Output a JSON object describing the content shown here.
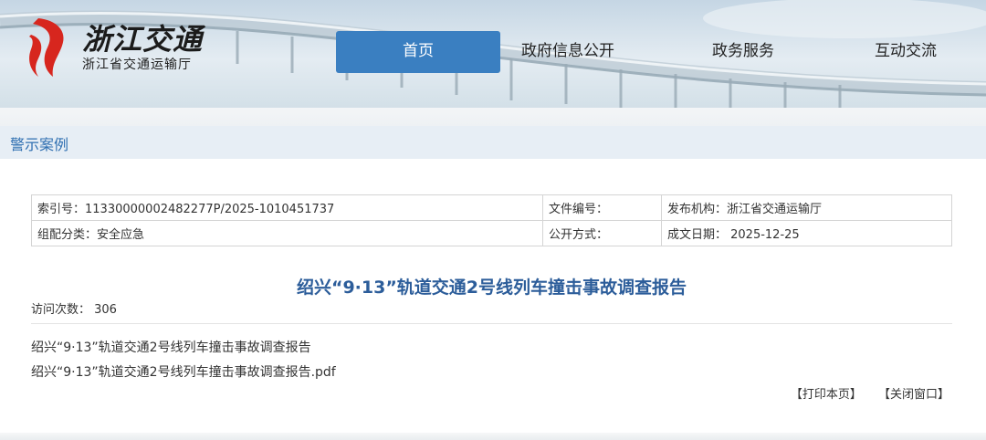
{
  "header": {
    "logo_title": "浙江交通",
    "logo_subtitle": "浙江省交通运输厅",
    "nav": [
      {
        "label": "首页",
        "active": true
      },
      {
        "label": "政府信息公开",
        "active": false
      },
      {
        "label": "政务服务",
        "active": false
      },
      {
        "label": "互动交流",
        "active": false
      }
    ]
  },
  "section": {
    "title": "警示案例"
  },
  "meta": {
    "index_no": "索引号：11330000002482277P/2025-1010451737",
    "file_no": "文件编号：",
    "publisher": "发布机构：浙江省交通运输厅",
    "category": "组配分类：安全应急",
    "disclosure": "公开方式：",
    "date": "成文日期： 2025-12-25"
  },
  "article": {
    "title": "绍兴“9·13”轨道交通2号线列车撞击事故调查报告",
    "visits": "访问次数： 306",
    "lines": [
      "绍兴“9·13”轨道交通2号线列车撞击事故调查报告",
      "绍兴“9·13”轨道交通2号线列车撞击事故调查报告.pdf"
    ]
  },
  "actions": {
    "print": "【打印本页】",
    "close": "【关闭窗口】"
  },
  "colors": {
    "nav_active": "#3a7fc1",
    "section_text": "#2f6fb1",
    "title_text": "#2c5d9a",
    "logo_red": "#d7261e"
  }
}
